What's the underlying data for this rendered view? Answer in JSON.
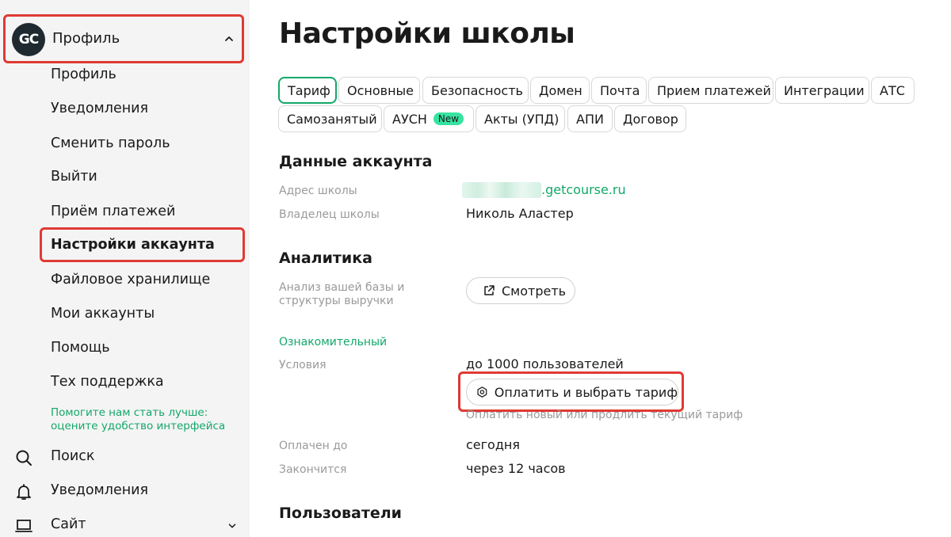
{
  "sidebar": {
    "profile": {
      "avatar_text": "GC",
      "label": "Профиль"
    },
    "submenu": [
      {
        "label": "Профиль"
      },
      {
        "label": "Уведомления"
      },
      {
        "label": "Сменить пароль"
      },
      {
        "label": "Выйти"
      },
      {
        "label": "Приём платежей"
      },
      {
        "label": "Настройки аккаунта",
        "active": true
      },
      {
        "label": "Файловое хранилище"
      },
      {
        "label": "Мои аккаунты"
      },
      {
        "label": "Помощь"
      },
      {
        "label": "Тех поддержка"
      }
    ],
    "feedback": {
      "line1": "Помогите нам стать лучше:",
      "line2": "оцените удобство интерфейса"
    },
    "nav": {
      "search": "Поиск",
      "notifications": "Уведомления",
      "site": "Сайт"
    }
  },
  "main": {
    "title": "Настройки школы",
    "tabs": [
      {
        "label": "Тариф",
        "active": true
      },
      {
        "label": "Основные"
      },
      {
        "label": "Безопасность"
      },
      {
        "label": "Домен"
      },
      {
        "label": "Почта"
      },
      {
        "label": "Прием платежей"
      },
      {
        "label": "Интеграции"
      },
      {
        "label": "АТС"
      },
      {
        "label": "Самозанятый"
      },
      {
        "label": "АУСН",
        "badge": "New"
      },
      {
        "label": "Акты (УПД)"
      },
      {
        "label": "АПИ"
      },
      {
        "label": "Договор"
      }
    ],
    "account": {
      "title": "Данные аккаунта",
      "school_address_label": "Адрес школы",
      "school_address_suffix": ".getcourse.ru",
      "owner_label": "Владелец школы",
      "owner_value": "Николь Аластер"
    },
    "analytics": {
      "title": "Аналитика",
      "label_line1": "Анализ вашей базы и",
      "label_line2": "структуры выручки",
      "view_button": "Смотреть"
    },
    "tariff": {
      "plan_name": "Ознакомительный",
      "conditions_label": "Условия",
      "conditions_value": "до 1000 пользователей",
      "pay_button": "Оплатить и выбрать тариф",
      "pay_hint": "Оплатить новый или продлить текущий тариф",
      "paid_until_label": "Оплачен до",
      "paid_until_value": "сегодня",
      "ends_label": "Закончится",
      "ends_value": "через 12 часов"
    },
    "users": {
      "title": "Пользователи"
    }
  },
  "colors": {
    "accent_green": "#13a86a",
    "highlight_red": "#e03a34",
    "sidebar_bg": "#f4f4f4",
    "avatar_bg": "#1f2a30",
    "badge_bg": "#36e3a0"
  }
}
